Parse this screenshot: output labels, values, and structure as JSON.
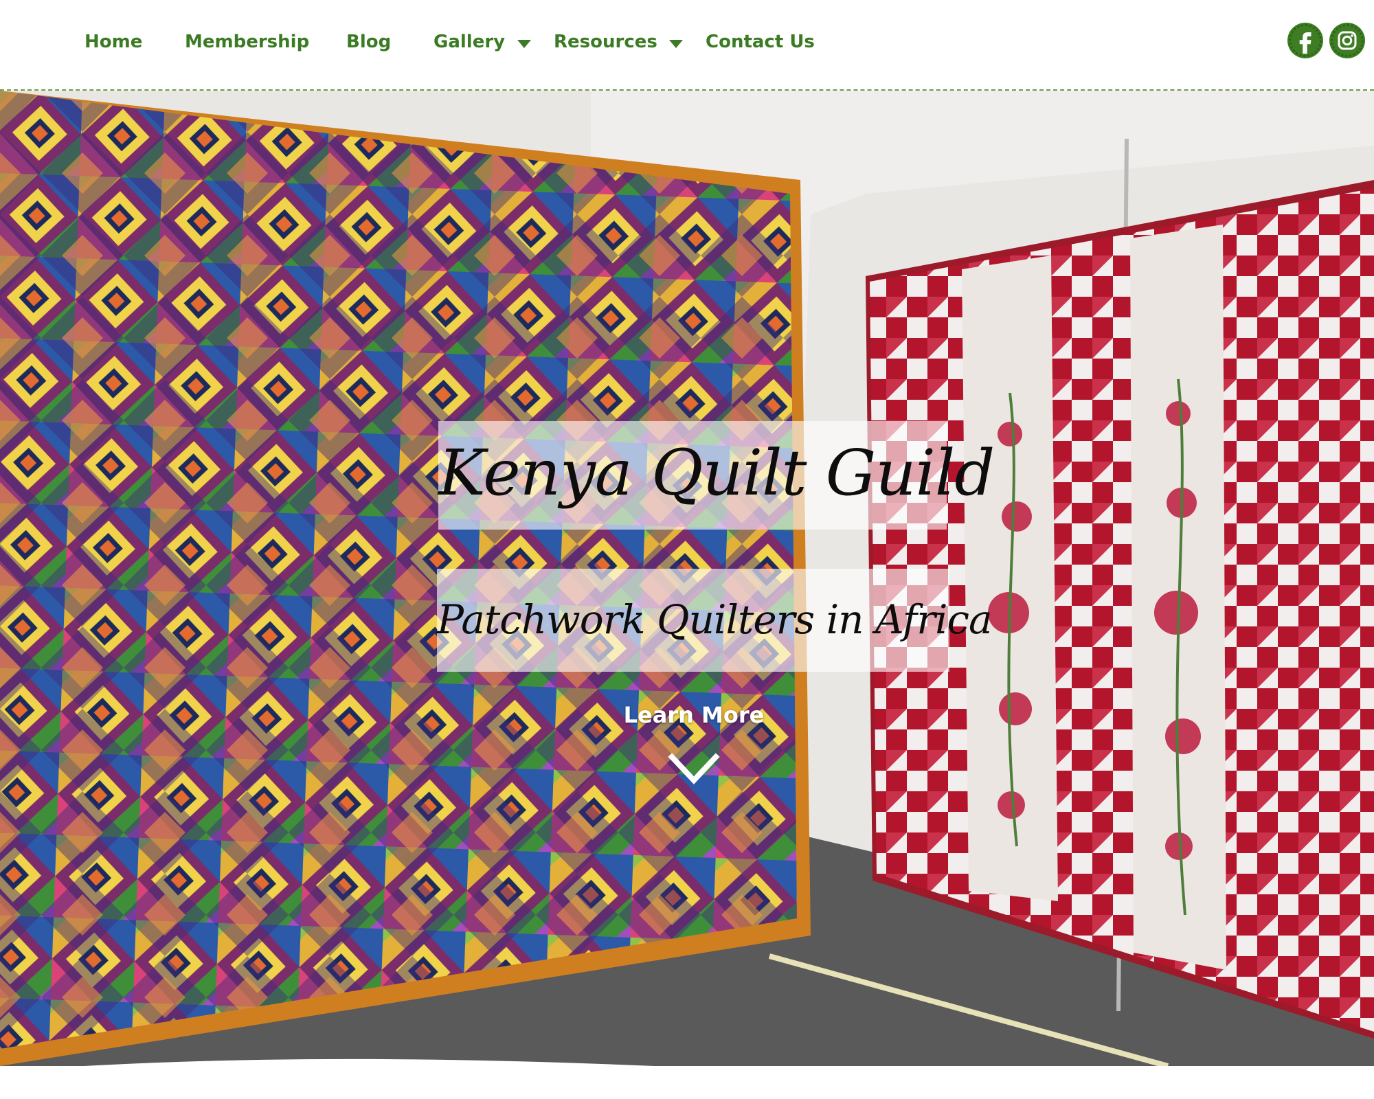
{
  "nav": {
    "items": [
      {
        "label": "Home"
      },
      {
        "label": "Membership"
      },
      {
        "label": "Blog"
      },
      {
        "label": "Gallery",
        "has_dropdown": true
      },
      {
        "label": "Resources",
        "has_dropdown": true
      },
      {
        "label": "Contact Us"
      }
    ]
  },
  "social": {
    "facebook_icon": "facebook-icon",
    "instagram_icon": "instagram-icon"
  },
  "hero": {
    "title": "Kenya Quilt Guild",
    "subtitle": "Patchwork Quilters in Africa",
    "cta_label": "Learn More",
    "cta_icon": "chevron-down-icon"
  },
  "colors": {
    "brand_green": "#3b7b24",
    "header_bg": "#ffffff",
    "quilt_red": "#b3152c"
  }
}
